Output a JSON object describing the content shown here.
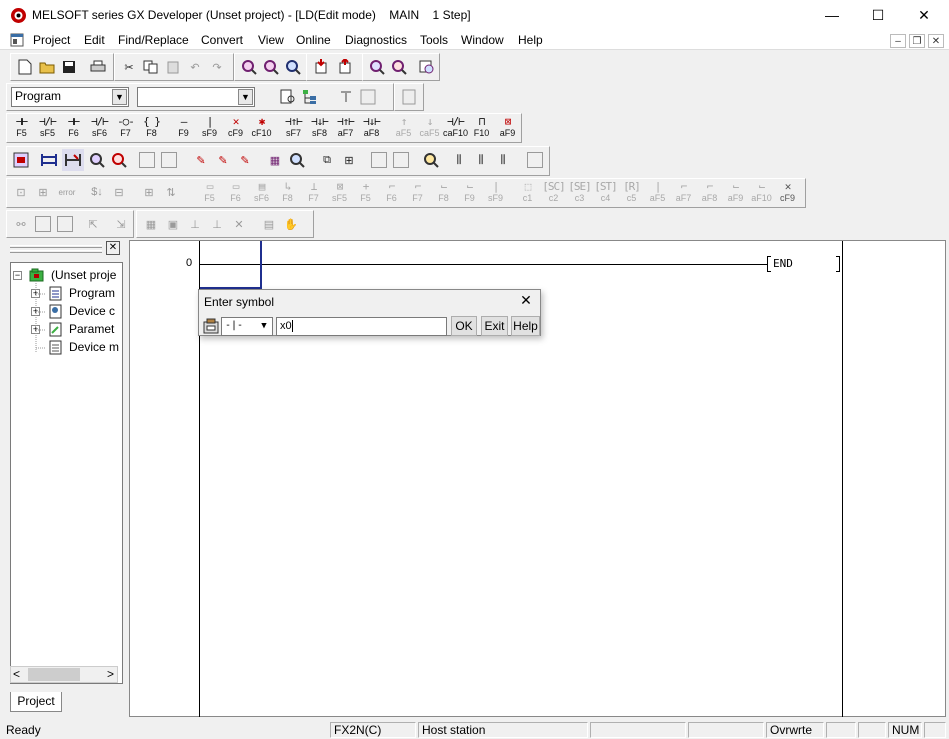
{
  "window": {
    "title": "MELSOFT series GX Developer (Unset project) - [LD(Edit mode)    MAIN    1 Step]",
    "minimize": "—",
    "maximize": "☐",
    "close": "✕"
  },
  "menu": {
    "items": [
      "Project",
      "Edit",
      "Find/Replace",
      "Convert",
      "View",
      "Online",
      "Diagnostics",
      "Tools",
      "Window",
      "Help"
    ],
    "mdi_minimize": "–",
    "mdi_restore": "❐",
    "mdi_close": "✕"
  },
  "toolbar": {
    "data_type_select": "Program",
    "program_select": ""
  },
  "ladder_keys": [
    {
      "symbol": "⊣⊢",
      "key": "F5"
    },
    {
      "symbol": "⊣/⊢",
      "key": "sF5"
    },
    {
      "symbol": "⊣⊢",
      "key": "F6"
    },
    {
      "symbol": "⊣/⊢",
      "key": "sF6"
    },
    {
      "symbol": "-○-",
      "key": "F7"
    },
    {
      "symbol": "{ }",
      "key": "F8"
    },
    {
      "symbol": "—",
      "key": "F9"
    },
    {
      "symbol": "|",
      "key": "sF9"
    },
    {
      "symbol": "✕",
      "key": "cF9"
    },
    {
      "symbol": "✱",
      "key": "cF10"
    },
    {
      "symbol": "⊣↑⊢",
      "key": "sF7"
    },
    {
      "symbol": "⊣↓⊢",
      "key": "sF8"
    },
    {
      "symbol": "⊣↑⊢",
      "key": "aF7"
    },
    {
      "symbol": "⊣↓⊢",
      "key": "aF8"
    },
    {
      "symbol": "↑",
      "key": "aF5"
    },
    {
      "symbol": "↓",
      "key": "caF5"
    },
    {
      "symbol": "⊣/⊢",
      "key": "caF10"
    },
    {
      "symbol": "⊓",
      "key": "F10"
    },
    {
      "symbol": "⊠",
      "key": "aF9"
    }
  ],
  "sfc_keys": [
    "F5",
    "F6",
    "sF6",
    "F8",
    "F7",
    "sF5",
    "F5",
    "F6",
    "F7",
    "F8",
    "F9",
    "sF9",
    "c1",
    "c2",
    "c3",
    "c4",
    "c5",
    "aF5",
    "aF7",
    "aF8",
    "aF9",
    "aF10",
    "cF9"
  ],
  "tree": {
    "root": "(Unset proje",
    "children": [
      "Program",
      "Device c",
      "Paramet",
      "Device m"
    ]
  },
  "left_panel": {
    "close": "✕",
    "tab": "Project",
    "scroll_left": "<",
    "scroll_right": ">"
  },
  "ladder": {
    "step": "0",
    "end_label": "END"
  },
  "dialog": {
    "title": "Enter symbol",
    "close": "✕",
    "symbol_select": "-|-",
    "input_value": "x0",
    "ok": "OK",
    "exit": "Exit",
    "help": "Help"
  },
  "status": {
    "ready": "Ready",
    "plc_type": "FX2N(C)",
    "station": "Host station",
    "mode": "Ovrwrte",
    "num": "NUM"
  },
  "colors": {
    "tree_green": "#3cb043",
    "cursor_blue": "#1f2f8f",
    "red_icon": "#c00000"
  }
}
